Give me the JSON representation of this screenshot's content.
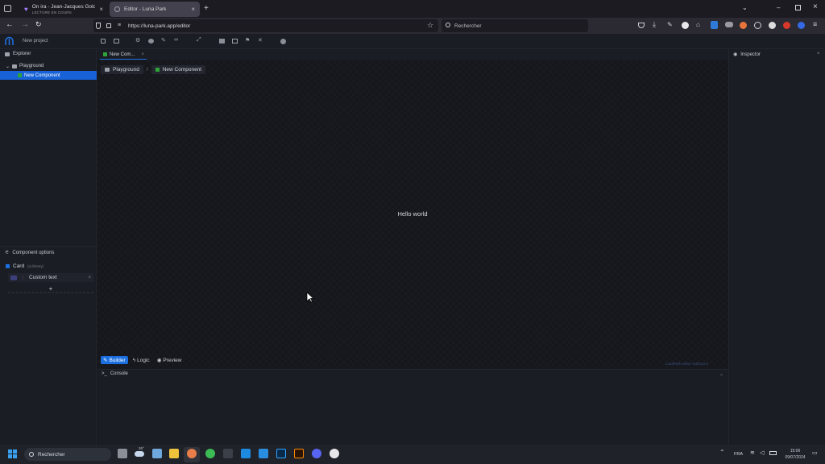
{
  "browser": {
    "tabs": [
      {
        "title": "On ira - Jean-Jacques Goldman",
        "subtitle": "LECTURE EN COURS"
      },
      {
        "title": "Editor - Luna Park"
      }
    ],
    "url": "https://luna-park.app/editor",
    "search_placeholder": "Rechercher",
    "new_tab_label": "+"
  },
  "app": {
    "project_name": "New project",
    "editor_tab": "New Com...",
    "explorer": {
      "title": "Explorer",
      "items": [
        {
          "label": "Playground"
        },
        {
          "label": "New Component"
        }
      ]
    },
    "breadcrumb": [
      "Playground",
      "/",
      "New Component"
    ],
    "canvas_text": "Hello world",
    "modes": [
      "Builder",
      "Logic",
      "Preview"
    ],
    "version": "LunaPark editor v2024.5.0",
    "inspector_title": "Inspector",
    "component_options": {
      "title": "Component options",
      "component": "Card",
      "component_note": "(ui.library)",
      "prop_label": "Custom text",
      "add_label": "+"
    },
    "console_title": "Console"
  },
  "taskbar": {
    "search": "Rechercher",
    "weather": "26°",
    "lang": "FRA",
    "time": "15:06",
    "date": "09/07/2024"
  },
  "colors": {
    "accent": "#1c6fe0",
    "selected_bg": "#1762d6",
    "component_green": "#2fa33a"
  }
}
